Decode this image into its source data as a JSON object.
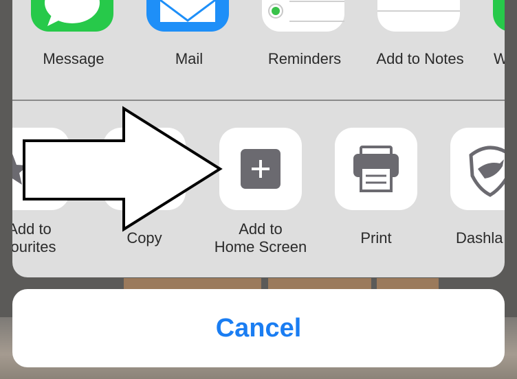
{
  "apps": [
    {
      "label": "Message",
      "icon": "messages-icon"
    },
    {
      "label": "Mail",
      "icon": "mail-icon"
    },
    {
      "label": "Reminders",
      "icon": "reminders-icon"
    },
    {
      "label": "Add to Notes",
      "icon": "notes-icon"
    },
    {
      "label": "W",
      "icon": "app-icon"
    }
  ],
  "actions": [
    {
      "label": "Add to\nvourites",
      "icon": "star-icon"
    },
    {
      "label": "Copy",
      "icon": "copy-icon"
    },
    {
      "label": "Add to\nHome Screen",
      "icon": "add-square-icon"
    },
    {
      "label": "Print",
      "icon": "printer-icon"
    },
    {
      "label": "Dashla",
      "icon": "dashlane-icon"
    }
  ],
  "cancel_label": "Cancel",
  "colors": {
    "accent": "#1a7df2",
    "sheet": "#dedede",
    "messages_green": "#27c94a",
    "mail_blue": "#1e8ff8",
    "icon_gray": "#6b6a70"
  }
}
